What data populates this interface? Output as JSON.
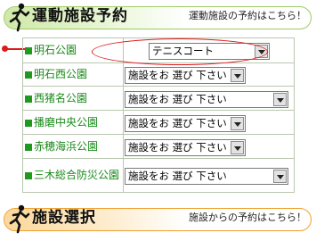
{
  "top_banner": {
    "title": "運動施設予約",
    "subtitle": "運動施設の予約はこちら！",
    "icon": "runner-figure-icon",
    "color": "#9ccc66"
  },
  "parks": [
    {
      "name": "明石公園",
      "selected": "テニスコート"
    },
    {
      "name": "明石西公園",
      "selected": "施設をお 選び 下さい"
    },
    {
      "name": "西猪名公園",
      "selected": "施設をお 選び 下さい"
    },
    {
      "name": "播磨中央公園",
      "selected": "施設をお 選び 下さい"
    },
    {
      "name": "赤穂海浜公園",
      "selected": "施設をお 選び 下さい"
    },
    {
      "name": "三木総合防災公園",
      "selected": "施設をお 選び 下さい"
    }
  ],
  "bottom_banner": {
    "title": "施設選択",
    "subtitle": "施設からの予約はこちら！",
    "icon": "runner-figure-icon",
    "color": "#f0a030"
  },
  "accent_colors": {
    "park_label": "#1a8a1a",
    "highlight": "#dd1a1a"
  }
}
